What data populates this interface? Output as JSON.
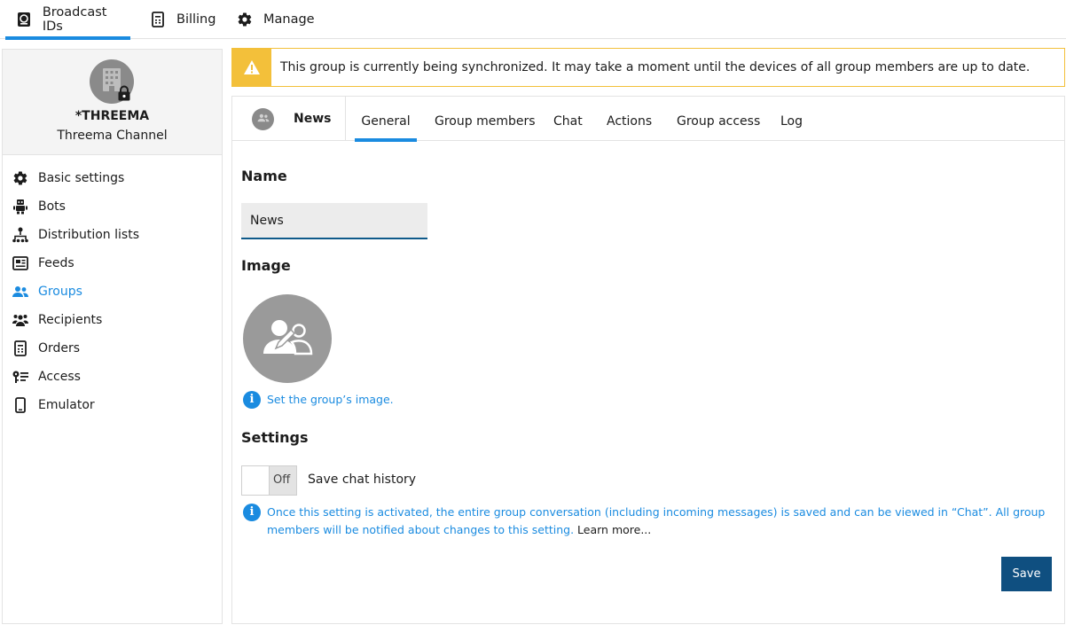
{
  "topnav": {
    "items": [
      {
        "label": "Broadcast IDs",
        "icon": "broadcast-id-icon"
      },
      {
        "label": "Billing",
        "icon": "billing-icon"
      },
      {
        "label": "Manage",
        "icon": "gear-icon"
      }
    ]
  },
  "sidebar": {
    "account_name": "*THREEMA",
    "account_sub": "Threema Channel",
    "items": [
      {
        "label": "Basic settings",
        "icon": "gear-icon"
      },
      {
        "label": "Bots",
        "icon": "robot-icon"
      },
      {
        "label": "Distribution lists",
        "icon": "hierarchy-icon"
      },
      {
        "label": "Feeds",
        "icon": "feed-icon"
      },
      {
        "label": "Groups",
        "icon": "groups-icon"
      },
      {
        "label": "Recipients",
        "icon": "recipients-icon"
      },
      {
        "label": "Orders",
        "icon": "orders-icon"
      },
      {
        "label": "Access",
        "icon": "key-icon"
      },
      {
        "label": "Emulator",
        "icon": "phone-icon"
      }
    ]
  },
  "alert": {
    "text": "This group is currently being synchronized. It may take a moment until the devices of all group members are up to date."
  },
  "group": {
    "name": "News",
    "tabs": [
      "General",
      "Group members",
      "Chat",
      "Actions",
      "Group access",
      "Log"
    ]
  },
  "general": {
    "name_heading": "Name",
    "name_value": "News",
    "image_heading": "Image",
    "image_hint": "Set the group’s image.",
    "settings_heading": "Settings",
    "toggle_state": "Off",
    "toggle_label": "Save chat history",
    "chat_hint": "Once this setting is activated, the entire group conversation (including incoming messages) is saved and can be viewed in “Chat”. All group members will be notified about changes to this setting. ",
    "learn_more": "Learn more...",
    "save_label": "Save"
  },
  "colors": {
    "accent": "#1a8be0",
    "warning": "#f3c03a",
    "primary_button": "#0f4f80"
  }
}
